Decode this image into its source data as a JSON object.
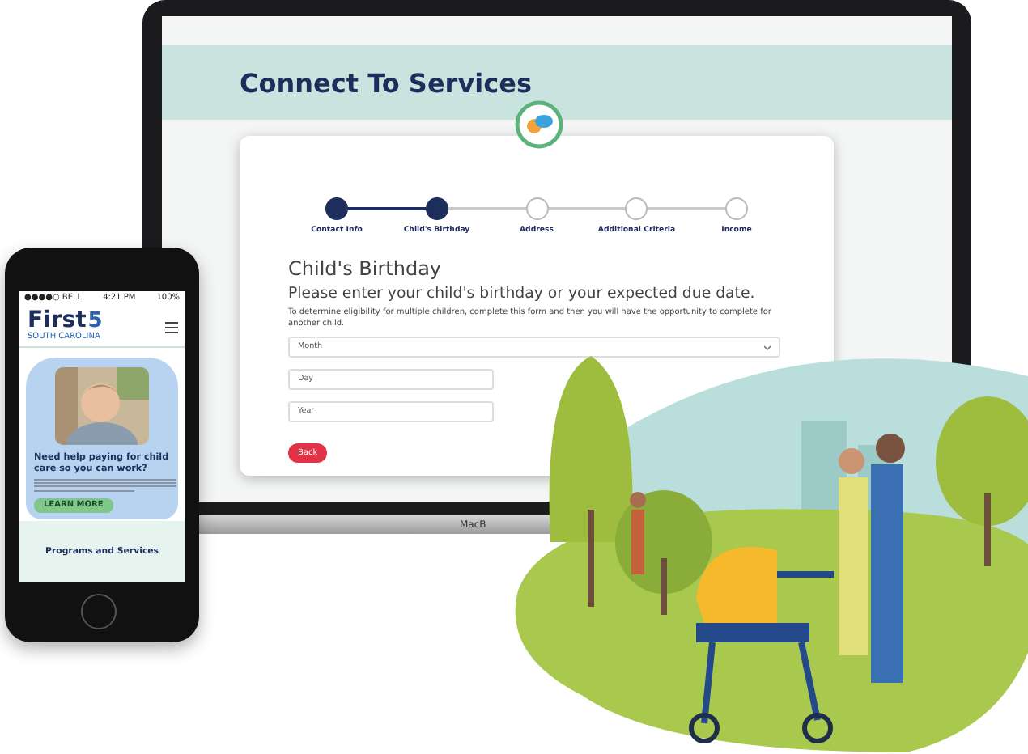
{
  "laptop": {
    "header_title": "Connect To Services",
    "steps": [
      {
        "label": "Contact Info",
        "completed": true
      },
      {
        "label": "Child's Birthday",
        "completed": true
      },
      {
        "label": "Address",
        "completed": false
      },
      {
        "label": "Additional Criteria",
        "completed": false
      },
      {
        "label": "Income",
        "completed": false
      }
    ],
    "form": {
      "heading": "Child's Birthday",
      "subheading": "Please enter your child's birthday or your expected due date.",
      "note": "To determine eligibility for multiple children, complete this form and then you will have the opportunity to complete for another child.",
      "fields": [
        {
          "placeholder": "Month",
          "kind": "select"
        },
        {
          "placeholder": "Day",
          "kind": "text"
        },
        {
          "placeholder": "Year",
          "kind": "text"
        }
      ],
      "back_button": "Back"
    },
    "brand": "MacB"
  },
  "phone": {
    "status": {
      "carrier": "●●●●○ BELL",
      "time": "4:21 PM",
      "battery": "100%"
    },
    "logo": {
      "word": "First",
      "digit": "5",
      "tagline": "SOUTH CAROLINA"
    },
    "promo": {
      "kind": "picture",
      "heading": "Need help paying for child care so you can work?",
      "button": "LEARN MORE"
    },
    "section_title": "Programs and Services"
  }
}
